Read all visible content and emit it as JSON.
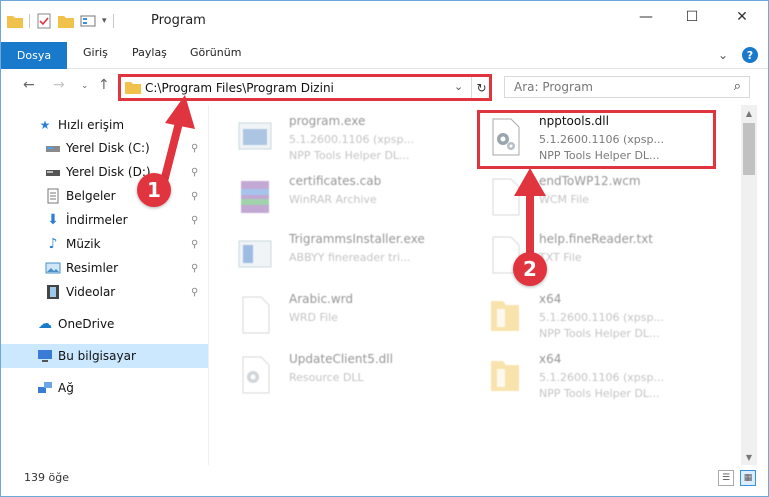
{
  "window": {
    "title": "Program",
    "minimize": "—",
    "maximize": "☐",
    "close": "✕"
  },
  "ribbon": {
    "tabs": [
      "Dosya",
      "Giriş",
      "Paylaş",
      "Görünüm"
    ],
    "expand": "⌄",
    "help": "?"
  },
  "address": {
    "path": "C:\\Program Files\\Program Dizini",
    "dropdown": "⌄",
    "refresh": "↻"
  },
  "search": {
    "placeholder": "Ara: Program",
    "icon": "⌕"
  },
  "sidebar": {
    "items": [
      {
        "label": "Hızlı erişim",
        "icon": "star-icon",
        "glyph": "★",
        "color": "#2b7fd6"
      },
      {
        "label": "Yerel Disk (C:)",
        "icon": "drive-icon",
        "glyph": "▬",
        "color": "#555555"
      },
      {
        "label": "Yerel Disk (D:)",
        "icon": "drive-icon",
        "glyph": "▬",
        "color": "#555555"
      },
      {
        "label": "Belgeler",
        "icon": "documents-icon",
        "glyph": "▤",
        "color": "#666666"
      },
      {
        "label": "İndirmeler",
        "icon": "download-icon",
        "glyph": "⬇",
        "color": "#2b7fd6"
      },
      {
        "label": "Müzik",
        "icon": "music-icon",
        "glyph": "♪",
        "color": "#2b7fd6"
      },
      {
        "label": "Resimler",
        "icon": "pictures-icon",
        "glyph": "▣",
        "color": "#4a90c8"
      },
      {
        "label": "Videolar",
        "icon": "video-icon",
        "glyph": "▦",
        "color": "#444444"
      },
      {
        "label": "OneDrive",
        "icon": "cloud-icon",
        "glyph": "☁",
        "color": "#1979ca"
      },
      {
        "label": "Bu bilgisayar",
        "icon": "computer-icon",
        "glyph": "🖵",
        "color": "#3a7bd5"
      },
      {
        "label": "Ağ",
        "icon": "network-icon",
        "glyph": "⛁",
        "color": "#3a7bd5"
      }
    ],
    "pin_glyph": "📌"
  },
  "files": [
    {
      "name": "program.exe",
      "line2": "5.1.2600.1106 (xpsp...",
      "line3": "NPP Tools Helper DL...",
      "icon": "exe-icon",
      "blurred": true
    },
    {
      "name": "npptools.dll",
      "line2": "5.1.2600.1106 (xpsp...",
      "line3": "NPP Tools Helper DL...",
      "icon": "dll-gear-icon",
      "blurred": false
    },
    {
      "name": "certificates.cab",
      "line2": "WinRAR Archive",
      "line3": "",
      "icon": "archive-icon",
      "blurred": true
    },
    {
      "name": "endToWP12.wcm",
      "line2": "WCM File",
      "line3": "",
      "icon": "file-icon",
      "blurred": true
    },
    {
      "name": "TrigrammsInstaller.exe",
      "line2": "ABBYY finereader tri...",
      "line3": "",
      "icon": "exe-icon",
      "blurred": true
    },
    {
      "name": "help.fineReader.txt",
      "line2": "TXT File",
      "line3": "",
      "icon": "file-icon",
      "blurred": true
    },
    {
      "name": "Arabic.wrd",
      "line2": "WRD File",
      "line3": "",
      "icon": "file-icon",
      "blurred": true
    },
    {
      "name": "x64",
      "line2": "5.1.2600.1106 (xpsp...",
      "line3": "NPP Tools Helper DL...",
      "icon": "folder-icon",
      "blurred": true
    },
    {
      "name": "UpdateClient5.dll",
      "line2": "Resource DLL",
      "line3": "",
      "icon": "dll-gear-icon",
      "blurred": true
    },
    {
      "name": "x64",
      "line2": "5.1.2600.1106 (xpsp...",
      "line3": "NPP Tools Helper DL...",
      "icon": "folder-icon",
      "blurred": true
    }
  ],
  "status": {
    "count": "139 öğe"
  },
  "annotations": {
    "badge1": "1",
    "badge2": "2"
  },
  "colors": {
    "accent": "#1979ca",
    "highlight": "#e0343f"
  }
}
